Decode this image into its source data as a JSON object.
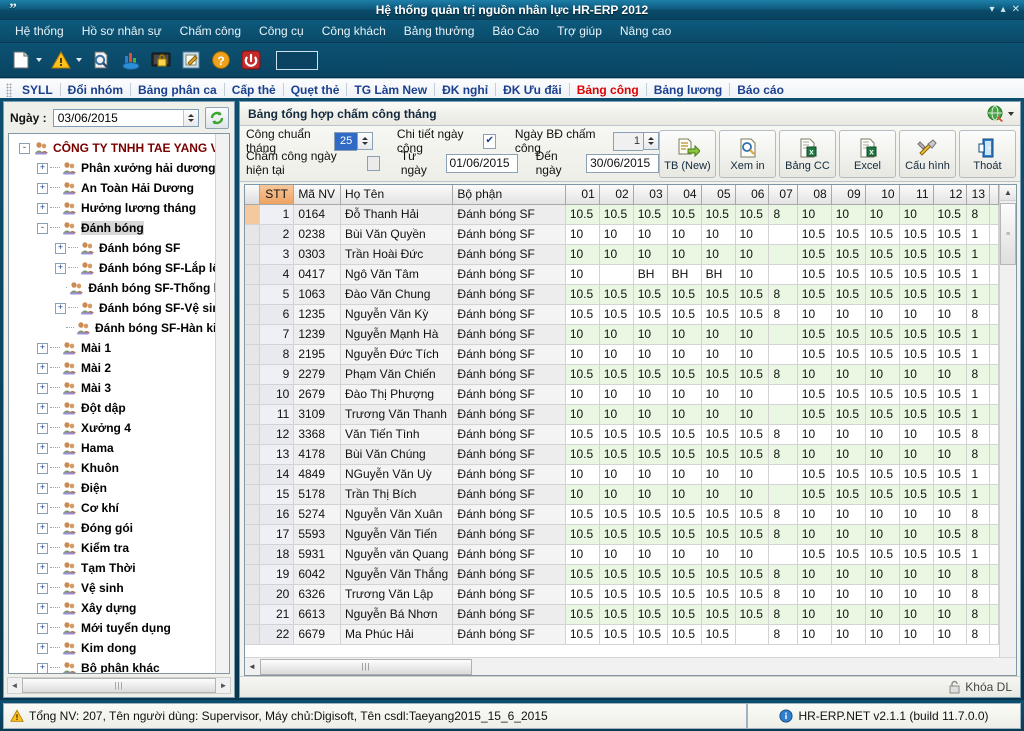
{
  "window": {
    "title": "Hệ thống quản trị nguồn nhân lực HR-ERP 2012",
    "logo_glyph": "”",
    "minimize": "▾",
    "restore": "▴",
    "close": "✕"
  },
  "menubar": {
    "items": [
      {
        "label": "Hệ thống",
        "name": "menu-he-thong"
      },
      {
        "label": "Hồ sơ nhân sự",
        "name": "menu-ho-so-nhan-su"
      },
      {
        "label": "Chấm công",
        "name": "menu-cham-cong"
      },
      {
        "label": "Công cụ",
        "name": "menu-cong-cu"
      },
      {
        "label": "Công khách",
        "name": "menu-cong-khach"
      },
      {
        "label": "Bảng thưởng",
        "name": "menu-bang-thuong"
      },
      {
        "label": "Báo Cáo",
        "name": "menu-bao-cao"
      },
      {
        "label": "Trợ giúp",
        "name": "menu-tro-giup"
      },
      {
        "label": "Nâng cao",
        "name": "menu-nang-cao"
      }
    ]
  },
  "icon_toolbar": {
    "items": [
      {
        "name": "new-document-icon",
        "has_caret": true
      },
      {
        "name": "warning-triangle-icon",
        "has_caret": true
      },
      {
        "name": "document-search-icon",
        "has_caret": false
      },
      {
        "name": "chart-pie-icon",
        "has_caret": false
      },
      {
        "name": "monitor-lock-icon",
        "has_caret": false
      },
      {
        "name": "edit-form-icon",
        "has_caret": false
      },
      {
        "name": "help-question-icon",
        "has_caret": false
      },
      {
        "name": "power-shutdown-icon",
        "has_caret": false
      }
    ],
    "textbox_value": ""
  },
  "subtabs": {
    "items": [
      {
        "label": "SYLL",
        "active": false
      },
      {
        "label": "Đổi nhóm",
        "active": false
      },
      {
        "label": "Bảng phân ca",
        "active": false
      },
      {
        "label": "Cấp thẻ",
        "active": false
      },
      {
        "label": "Quẹt thẻ",
        "active": false
      },
      {
        "label": "TG Làm New",
        "active": false
      },
      {
        "label": "ĐK nghỉ",
        "active": false
      },
      {
        "label": "ĐK Ưu đãi",
        "active": false
      },
      {
        "label": "Bảng công",
        "active": true
      },
      {
        "label": "Bảng lương",
        "active": false
      },
      {
        "label": "Báo cáo",
        "active": false
      }
    ],
    "active_color": "#e00000",
    "normal_color": "#1b3f8f"
  },
  "left_panel": {
    "date_label": "Ngày :",
    "date_value": "03/06/2015",
    "refresh_name": "refresh-button",
    "tree": [
      {
        "label": "CÔNG TY TNHH TAE YANG VIỆT",
        "depth": 0,
        "expander": "-",
        "bold": true,
        "selected": false
      },
      {
        "label": "Phân xưởng hải dương",
        "depth": 1,
        "expander": "+",
        "bold": true,
        "selected": false
      },
      {
        "label": "An Toàn Hải Dương",
        "depth": 1,
        "expander": "+",
        "bold": true,
        "selected": false
      },
      {
        "label": "Hưởng lương tháng",
        "depth": 1,
        "expander": "+",
        "bold": true,
        "selected": false
      },
      {
        "label": "Đánh bóng",
        "depth": 1,
        "expander": "-",
        "bold": true,
        "selected": true
      },
      {
        "label": "Đánh bóng SF",
        "depth": 2,
        "expander": "+",
        "bold": true,
        "selected": false
      },
      {
        "label": "Đánh bóng SF-Lắp lô",
        "depth": 2,
        "expander": "+",
        "bold": true,
        "selected": false
      },
      {
        "label": "Đánh bóng SF-Thống kê",
        "depth": 2,
        "expander": "",
        "bold": true,
        "selected": false
      },
      {
        "label": "Đánh bóng SF-Vệ sinh",
        "depth": 2,
        "expander": "+",
        "bold": true,
        "selected": false
      },
      {
        "label": "Đánh bóng SF-Hàn kim",
        "depth": 2,
        "expander": "",
        "bold": true,
        "selected": false
      },
      {
        "label": "Mài 1",
        "depth": 1,
        "expander": "+",
        "bold": true,
        "selected": false
      },
      {
        "label": "Mài 2",
        "depth": 1,
        "expander": "+",
        "bold": true,
        "selected": false
      },
      {
        "label": "Mài 3",
        "depth": 1,
        "expander": "+",
        "bold": true,
        "selected": false
      },
      {
        "label": "Đột dập",
        "depth": 1,
        "expander": "+",
        "bold": true,
        "selected": false
      },
      {
        "label": "Xưởng 4",
        "depth": 1,
        "expander": "+",
        "bold": true,
        "selected": false
      },
      {
        "label": "Hama",
        "depth": 1,
        "expander": "+",
        "bold": true,
        "selected": false
      },
      {
        "label": "Khuôn",
        "depth": 1,
        "expander": "+",
        "bold": true,
        "selected": false
      },
      {
        "label": "Điện",
        "depth": 1,
        "expander": "+",
        "bold": true,
        "selected": false
      },
      {
        "label": "Cơ khí",
        "depth": 1,
        "expander": "+",
        "bold": true,
        "selected": false
      },
      {
        "label": "Đóng gói",
        "depth": 1,
        "expander": "+",
        "bold": true,
        "selected": false
      },
      {
        "label": "Kiểm tra",
        "depth": 1,
        "expander": "+",
        "bold": true,
        "selected": false
      },
      {
        "label": "Tạm Thời",
        "depth": 1,
        "expander": "+",
        "bold": true,
        "selected": false
      },
      {
        "label": "Vệ sinh",
        "depth": 1,
        "expander": "+",
        "bold": true,
        "selected": false
      },
      {
        "label": "Xây dựng",
        "depth": 1,
        "expander": "+",
        "bold": true,
        "selected": false
      },
      {
        "label": "Mới tuyển dụng",
        "depth": 1,
        "expander": "+",
        "bold": true,
        "selected": false
      },
      {
        "label": "Kim dong",
        "depth": 1,
        "expander": "+",
        "bold": true,
        "selected": false
      },
      {
        "label": "Bộ phận khác",
        "depth": 1,
        "expander": "+",
        "bold": true,
        "selected": false
      }
    ]
  },
  "right_panel": {
    "title": "Bảng tổng hợp chấm công tháng",
    "globe_icon": "globe-icon",
    "filters": {
      "cong_chuan_label": "Công chuẩn tháng",
      "cong_chuan_value": "25",
      "chi_tiet_label": "Chi tiết ngày công",
      "chi_tiet_checked": true,
      "ngay_bd_label": "Ngày BĐ chấm công",
      "ngay_bd_value": "1",
      "cham_cong_hien_tai_label": "Chấm công ngày hiện tại",
      "cham_cong_hien_tai_checked": false,
      "tu_ngay_label": "Từ ngày",
      "tu_ngay_value": "01/06/2015",
      "den_ngay_label": "Đến ngày",
      "den_ngay_value": "30/06/2015"
    },
    "buttons": [
      {
        "label": "TB (New)",
        "icon": "report-run-icon",
        "name": "tb-new-button"
      },
      {
        "label": "Xem in",
        "icon": "print-preview-icon",
        "name": "xem-in-button"
      },
      {
        "label": "Bảng CC",
        "icon": "excel-sheet-icon",
        "name": "bang-cc-button"
      },
      {
        "label": "Excel",
        "icon": "excel-sheet-icon",
        "name": "excel-button"
      },
      {
        "label": "Cấu hình",
        "icon": "tools-icon",
        "name": "cau-hinh-button"
      },
      {
        "label": "Thoát",
        "icon": "exit-door-icon",
        "name": "thoat-button"
      }
    ],
    "footer_lock_label": "Khóa DL",
    "footer_lock_icon": "padlock-icon"
  },
  "grid": {
    "columns": [
      "STT",
      "Mã NV",
      "Họ Tên",
      "Bộ phận",
      "01",
      "02",
      "03",
      "04",
      "05",
      "06",
      "07",
      "08",
      "09",
      "10",
      "11",
      "12",
      "13"
    ],
    "rows": [
      {
        "stt": "1",
        "manv": "0164",
        "hoten": "Đỗ Thanh Hải",
        "bophan": "Đánh bóng SF",
        "days": [
          "10.5",
          "10.5",
          "10.5",
          "10.5",
          "10.5",
          "10.5",
          "8",
          "10",
          "10",
          "10",
          "10",
          "10.5",
          "8"
        ]
      },
      {
        "stt": "2",
        "manv": "0238",
        "hoten": "Bùi Văn Quyền",
        "bophan": "Đánh bóng SF",
        "days": [
          "10",
          "10",
          "10",
          "10",
          "10",
          "10",
          "",
          "10.5",
          "10.5",
          "10.5",
          "10.5",
          "10.5",
          "1"
        ]
      },
      {
        "stt": "3",
        "manv": "0303",
        "hoten": "Trần Hoài Đức",
        "bophan": "Đánh bóng SF",
        "days": [
          "10",
          "10",
          "10",
          "10",
          "10",
          "10",
          "",
          "10.5",
          "10.5",
          "10.5",
          "10.5",
          "10.5",
          "1"
        ]
      },
      {
        "stt": "4",
        "manv": "0417",
        "hoten": "Ngô Văn Tâm",
        "bophan": "Đánh bóng SF",
        "days": [
          "10",
          "",
          "BH",
          "BH",
          "BH",
          "10",
          "",
          "10.5",
          "10.5",
          "10.5",
          "10.5",
          "10.5",
          "1"
        ]
      },
      {
        "stt": "5",
        "manv": "1063",
        "hoten": "Đào Văn Chung",
        "bophan": "Đánh bóng SF",
        "days": [
          "10.5",
          "10.5",
          "10.5",
          "10.5",
          "10.5",
          "10.5",
          "8",
          "10.5",
          "10.5",
          "10.5",
          "10.5",
          "10.5",
          "1"
        ]
      },
      {
        "stt": "6",
        "manv": "1235",
        "hoten": "Nguyễn Văn Kỳ",
        "bophan": "Đánh bóng SF",
        "days": [
          "10.5",
          "10.5",
          "10.5",
          "10.5",
          "10.5",
          "10.5",
          "8",
          "10",
          "10",
          "10",
          "10",
          "10",
          "8"
        ]
      },
      {
        "stt": "7",
        "manv": "1239",
        "hoten": "Nguyễn Mạnh Hà",
        "bophan": "Đánh bóng SF",
        "days": [
          "10",
          "10",
          "10",
          "10",
          "10",
          "10",
          "",
          "10.5",
          "10.5",
          "10.5",
          "10.5",
          "10.5",
          "1"
        ]
      },
      {
        "stt": "8",
        "manv": "2195",
        "hoten": "Nguyễn Đức Tích",
        "bophan": "Đánh bóng SF",
        "days": [
          "10",
          "10",
          "10",
          "10",
          "10",
          "10",
          "",
          "10.5",
          "10.5",
          "10.5",
          "10.5",
          "10.5",
          "1"
        ]
      },
      {
        "stt": "9",
        "manv": "2279",
        "hoten": "Phạm Văn Chiến",
        "bophan": "Đánh bóng SF",
        "days": [
          "10.5",
          "10.5",
          "10.5",
          "10.5",
          "10.5",
          "10.5",
          "8",
          "10",
          "10",
          "10",
          "10",
          "10",
          "8"
        ]
      },
      {
        "stt": "10",
        "manv": "2679",
        "hoten": "Đào Thị Phượng",
        "bophan": "Đánh bóng SF",
        "days": [
          "10",
          "10",
          "10",
          "10",
          "10",
          "10",
          "",
          "10.5",
          "10.5",
          "10.5",
          "10.5",
          "10.5",
          "1"
        ]
      },
      {
        "stt": "11",
        "manv": "3109",
        "hoten": "Trương Văn Thanh",
        "bophan": "Đánh bóng SF",
        "days": [
          "10",
          "10",
          "10",
          "10",
          "10",
          "10",
          "",
          "10.5",
          "10.5",
          "10.5",
          "10.5",
          "10.5",
          "1"
        ]
      },
      {
        "stt": "12",
        "manv": "3368",
        "hoten": "Văn Tiến Tình",
        "bophan": "Đánh bóng SF",
        "days": [
          "10.5",
          "10.5",
          "10.5",
          "10.5",
          "10.5",
          "10.5",
          "8",
          "10",
          "10",
          "10",
          "10",
          "10.5",
          "8"
        ]
      },
      {
        "stt": "13",
        "manv": "4178",
        "hoten": "Bùi Văn Chúng",
        "bophan": "Đánh bóng SF",
        "days": [
          "10.5",
          "10.5",
          "10.5",
          "10.5",
          "10.5",
          "10.5",
          "8",
          "10",
          "10",
          "10",
          "10",
          "10",
          "8"
        ]
      },
      {
        "stt": "14",
        "manv": "4849",
        "hoten": "NGuyễn Văn Uỳ",
        "bophan": "Đánh bóng SF",
        "days": [
          "10",
          "10",
          "10",
          "10",
          "10",
          "10",
          "",
          "10.5",
          "10.5",
          "10.5",
          "10.5",
          "10.5",
          "1"
        ]
      },
      {
        "stt": "15",
        "manv": "5178",
        "hoten": "Trần Thị Bích",
        "bophan": "Đánh bóng SF",
        "days": [
          "10",
          "10",
          "10",
          "10",
          "10",
          "10",
          "",
          "10.5",
          "10.5",
          "10.5",
          "10.5",
          "10.5",
          "1"
        ]
      },
      {
        "stt": "16",
        "manv": "5274",
        "hoten": "Nguyễn Văn Xuân",
        "bophan": "Đánh bóng SF",
        "days": [
          "10.5",
          "10.5",
          "10.5",
          "10.5",
          "10.5",
          "10.5",
          "8",
          "10",
          "10",
          "10",
          "10",
          "10",
          "8"
        ]
      },
      {
        "stt": "17",
        "manv": "5593",
        "hoten": "Nguyễn Văn Tiến",
        "bophan": "Đánh bóng SF",
        "days": [
          "10.5",
          "10.5",
          "10.5",
          "10.5",
          "10.5",
          "10.5",
          "8",
          "10",
          "10",
          "10",
          "10",
          "10.5",
          "8"
        ]
      },
      {
        "stt": "18",
        "manv": "5931",
        "hoten": "Nguyễn văn Quang",
        "bophan": "Đánh bóng SF",
        "days": [
          "10",
          "10",
          "10",
          "10",
          "10",
          "10",
          "",
          "10.5",
          "10.5",
          "10.5",
          "10.5",
          "10.5",
          "1"
        ]
      },
      {
        "stt": "19",
        "manv": "6042",
        "hoten": "Nguyễn Văn Thắng",
        "bophan": "Đánh bóng SF",
        "days": [
          "10.5",
          "10.5",
          "10.5",
          "10.5",
          "10.5",
          "10.5",
          "8",
          "10",
          "10",
          "10",
          "10",
          "10",
          "8"
        ]
      },
      {
        "stt": "20",
        "manv": "6326",
        "hoten": "Trương Văn Lập",
        "bophan": "Đánh bóng SF",
        "days": [
          "10.5",
          "10.5",
          "10.5",
          "10.5",
          "10.5",
          "10.5",
          "8",
          "10",
          "10",
          "10",
          "10",
          "10",
          "8"
        ]
      },
      {
        "stt": "21",
        "manv": "6613",
        "hoten": "Nguyễn Bá Nhơn",
        "bophan": "Đánh bóng SF",
        "days": [
          "10.5",
          "10.5",
          "10.5",
          "10.5",
          "10.5",
          "10.5",
          "8",
          "10",
          "10",
          "10",
          "10",
          "10",
          "8"
        ]
      },
      {
        "stt": "22",
        "manv": "6679",
        "hoten": "Ma Phúc Hải",
        "bophan": "Đánh bóng SF",
        "days": [
          "10.5",
          "10.5",
          "10.5",
          "10.5",
          "10.5",
          "",
          "8",
          "10",
          "10",
          "10",
          "10",
          "10",
          "8"
        ]
      }
    ]
  },
  "statusbar": {
    "left_text": "Tổng NV: 207, Tên người dùng: Supervisor, Máy chủ:Digisoft, Tên csdl:Taeyang2015_15_6_2015",
    "left_icon": "warning-triangle-icon",
    "right_text": "HR-ERP.NET v2.1.1 (build 11.7.0.0)",
    "right_icon": "info-circle-icon"
  },
  "colors": {
    "chrome": "#0a4a68",
    "accent_orange": "#eda263",
    "tab_active": "#e00000",
    "tab_normal": "#1b3f8f",
    "row_green": "#e9f7e3"
  }
}
